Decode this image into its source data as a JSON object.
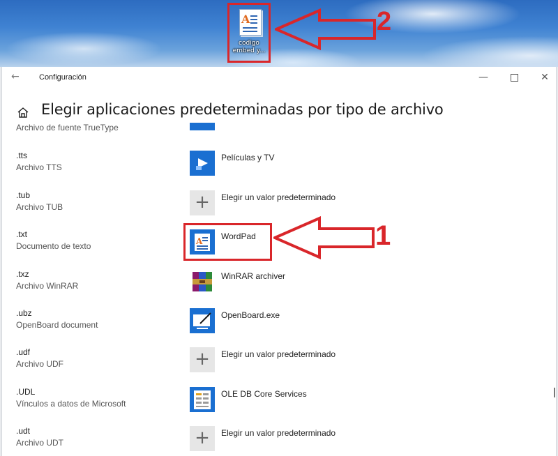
{
  "desktop": {
    "icon_label": "codigo embed y...",
    "annotation_number": "2"
  },
  "window": {
    "title": "Configuración",
    "page_title": "Elegir aplicaciones predeterminadas por tipo de archivo"
  },
  "rows": [
    {
      "ext": "",
      "desc": "Archivo de fuente TrueType",
      "app": "",
      "icon": "font-icon"
    },
    {
      "ext": ".tts",
      "desc": "Archivo TTS",
      "app": "Películas y TV",
      "icon": "movies-tv-icon"
    },
    {
      "ext": ".tub",
      "desc": "Archivo TUB",
      "app": "Elegir un valor predeterminado",
      "icon": "plus-icon"
    },
    {
      "ext": ".txt",
      "desc": "Documento de texto",
      "app": "WordPad",
      "icon": "wordpad-icon"
    },
    {
      "ext": ".txz",
      "desc": "Archivo WinRAR",
      "app": "WinRAR archiver",
      "icon": "winrar-icon"
    },
    {
      "ext": ".ubz",
      "desc": "OpenBoard document",
      "app": "OpenBoard.exe",
      "icon": "openboard-icon"
    },
    {
      "ext": ".udf",
      "desc": "Archivo UDF",
      "app": "Elegir un valor predeterminado",
      "icon": "plus-icon"
    },
    {
      "ext": ".UDL",
      "desc": "Vínculos a datos de Microsoft",
      "app": "OLE DB Core Services",
      "icon": "oledb-icon"
    },
    {
      "ext": ".udt",
      "desc": "Archivo UDT",
      "app": "Elegir un valor predeterminado",
      "icon": "plus-icon"
    }
  ],
  "annotation_number_1": "1",
  "colors": {
    "annotation_red": "#d9262a",
    "accent_blue": "#1a6fd1"
  }
}
